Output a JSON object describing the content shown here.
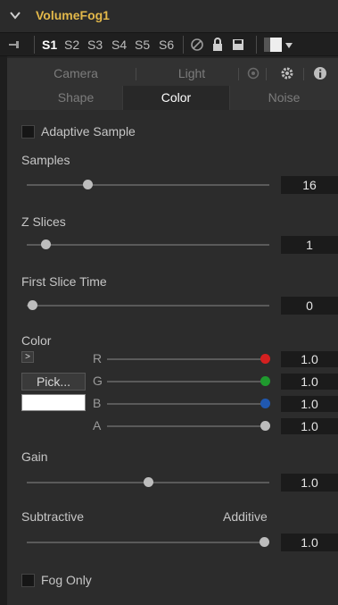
{
  "tool": {
    "name": "VolumeFog1"
  },
  "versions": {
    "items": [
      "S1",
      "S2",
      "S3",
      "S4",
      "S5",
      "S6"
    ],
    "active": "S1"
  },
  "tabs": {
    "row1": [
      "Camera",
      "Light"
    ],
    "row2": [
      "Shape",
      "Color",
      "Noise"
    ],
    "active": "Color"
  },
  "controls": {
    "adaptive_sample": {
      "label": "Adaptive Sample",
      "checked": false
    },
    "samples": {
      "label": "Samples",
      "value": "16",
      "fraction": 0.25
    },
    "z_slices": {
      "label": "Z Slices",
      "value": "1",
      "fraction": 0.08
    },
    "first_slice_time": {
      "label": "First Slice Time",
      "value": "0",
      "fraction": 0.0
    },
    "color": {
      "label": "Color",
      "expand": ">",
      "pick_label": "Pick...",
      "swatch_color": "#ffffff",
      "channels": [
        {
          "name": "R",
          "value": "1.0",
          "color": "#d42020"
        },
        {
          "name": "G",
          "value": "1.0",
          "color": "#1f9a2e"
        },
        {
          "name": "B",
          "value": "1.0",
          "color": "#2058b0"
        },
        {
          "name": "A",
          "value": "1.0",
          "color": "#bdbdbd"
        }
      ]
    },
    "gain": {
      "label": "Gain",
      "value": "1.0",
      "fraction": 0.5
    },
    "subtractive_additive": {
      "left_label": "Subtractive",
      "right_label": "Additive",
      "value": "1.0",
      "fraction": 1.0
    },
    "fog_only": {
      "label": "Fog Only",
      "checked": false
    }
  },
  "colors": {
    "accent": "#e3b84a",
    "background": "#2c2c2c"
  },
  "icons": [
    "chevron-down-icon",
    "pin-icon",
    "no-entry-icon",
    "lock-icon",
    "save-icon",
    "color-swatch-icon",
    "dropdown-icon",
    "camera-icon",
    "gear-icon",
    "info-icon"
  ]
}
